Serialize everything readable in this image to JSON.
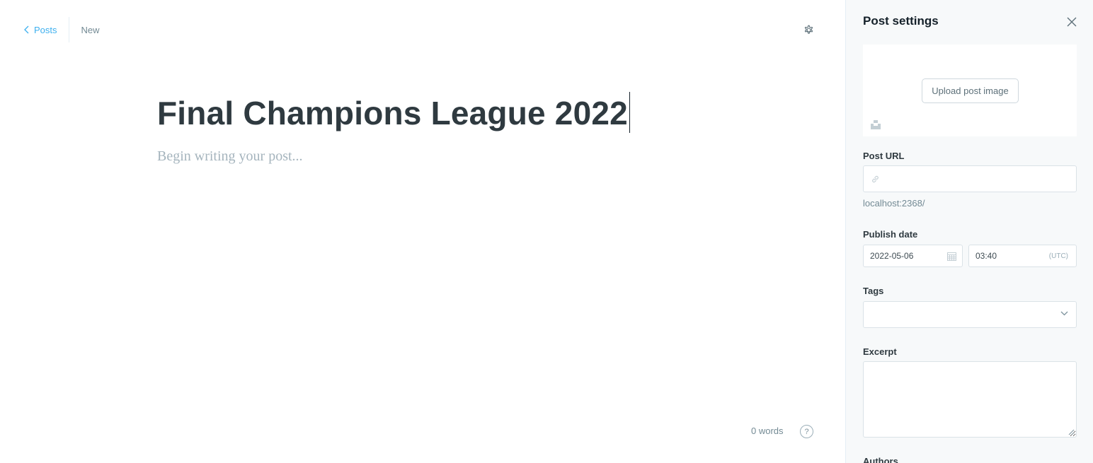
{
  "header": {
    "back_label": "Posts",
    "status": "New"
  },
  "post": {
    "title": "Final Champions League 2022",
    "body_placeholder": "Begin writing your post..."
  },
  "footer": {
    "word_count": "0 words",
    "help_glyph": "?"
  },
  "settings": {
    "title": "Post settings",
    "upload_label": "Upload post image",
    "post_url": {
      "label": "Post URL",
      "value": "",
      "hint": "localhost:2368/"
    },
    "publish_date": {
      "label": "Publish date",
      "date": "2022-05-06",
      "time": "03:40",
      "timezone": "(UTC)"
    },
    "tags": {
      "label": "Tags",
      "value": ""
    },
    "excerpt": {
      "label": "Excerpt",
      "value": ""
    },
    "authors": {
      "label": "Authors"
    }
  },
  "icons": {
    "back": "chevron-left-icon",
    "settings": "gear-icon",
    "close": "close-icon",
    "unsplash": "unsplash-icon",
    "link": "link-icon",
    "calendar": "calendar-icon",
    "dropdown": "chevron-down-icon",
    "help": "help-icon"
  },
  "colors": {
    "accent": "#3eb0ef",
    "panel_bg": "#f7f9fa",
    "title_text": "#2f3a40",
    "placeholder": "#a5b4bd",
    "muted": "#738a94"
  }
}
